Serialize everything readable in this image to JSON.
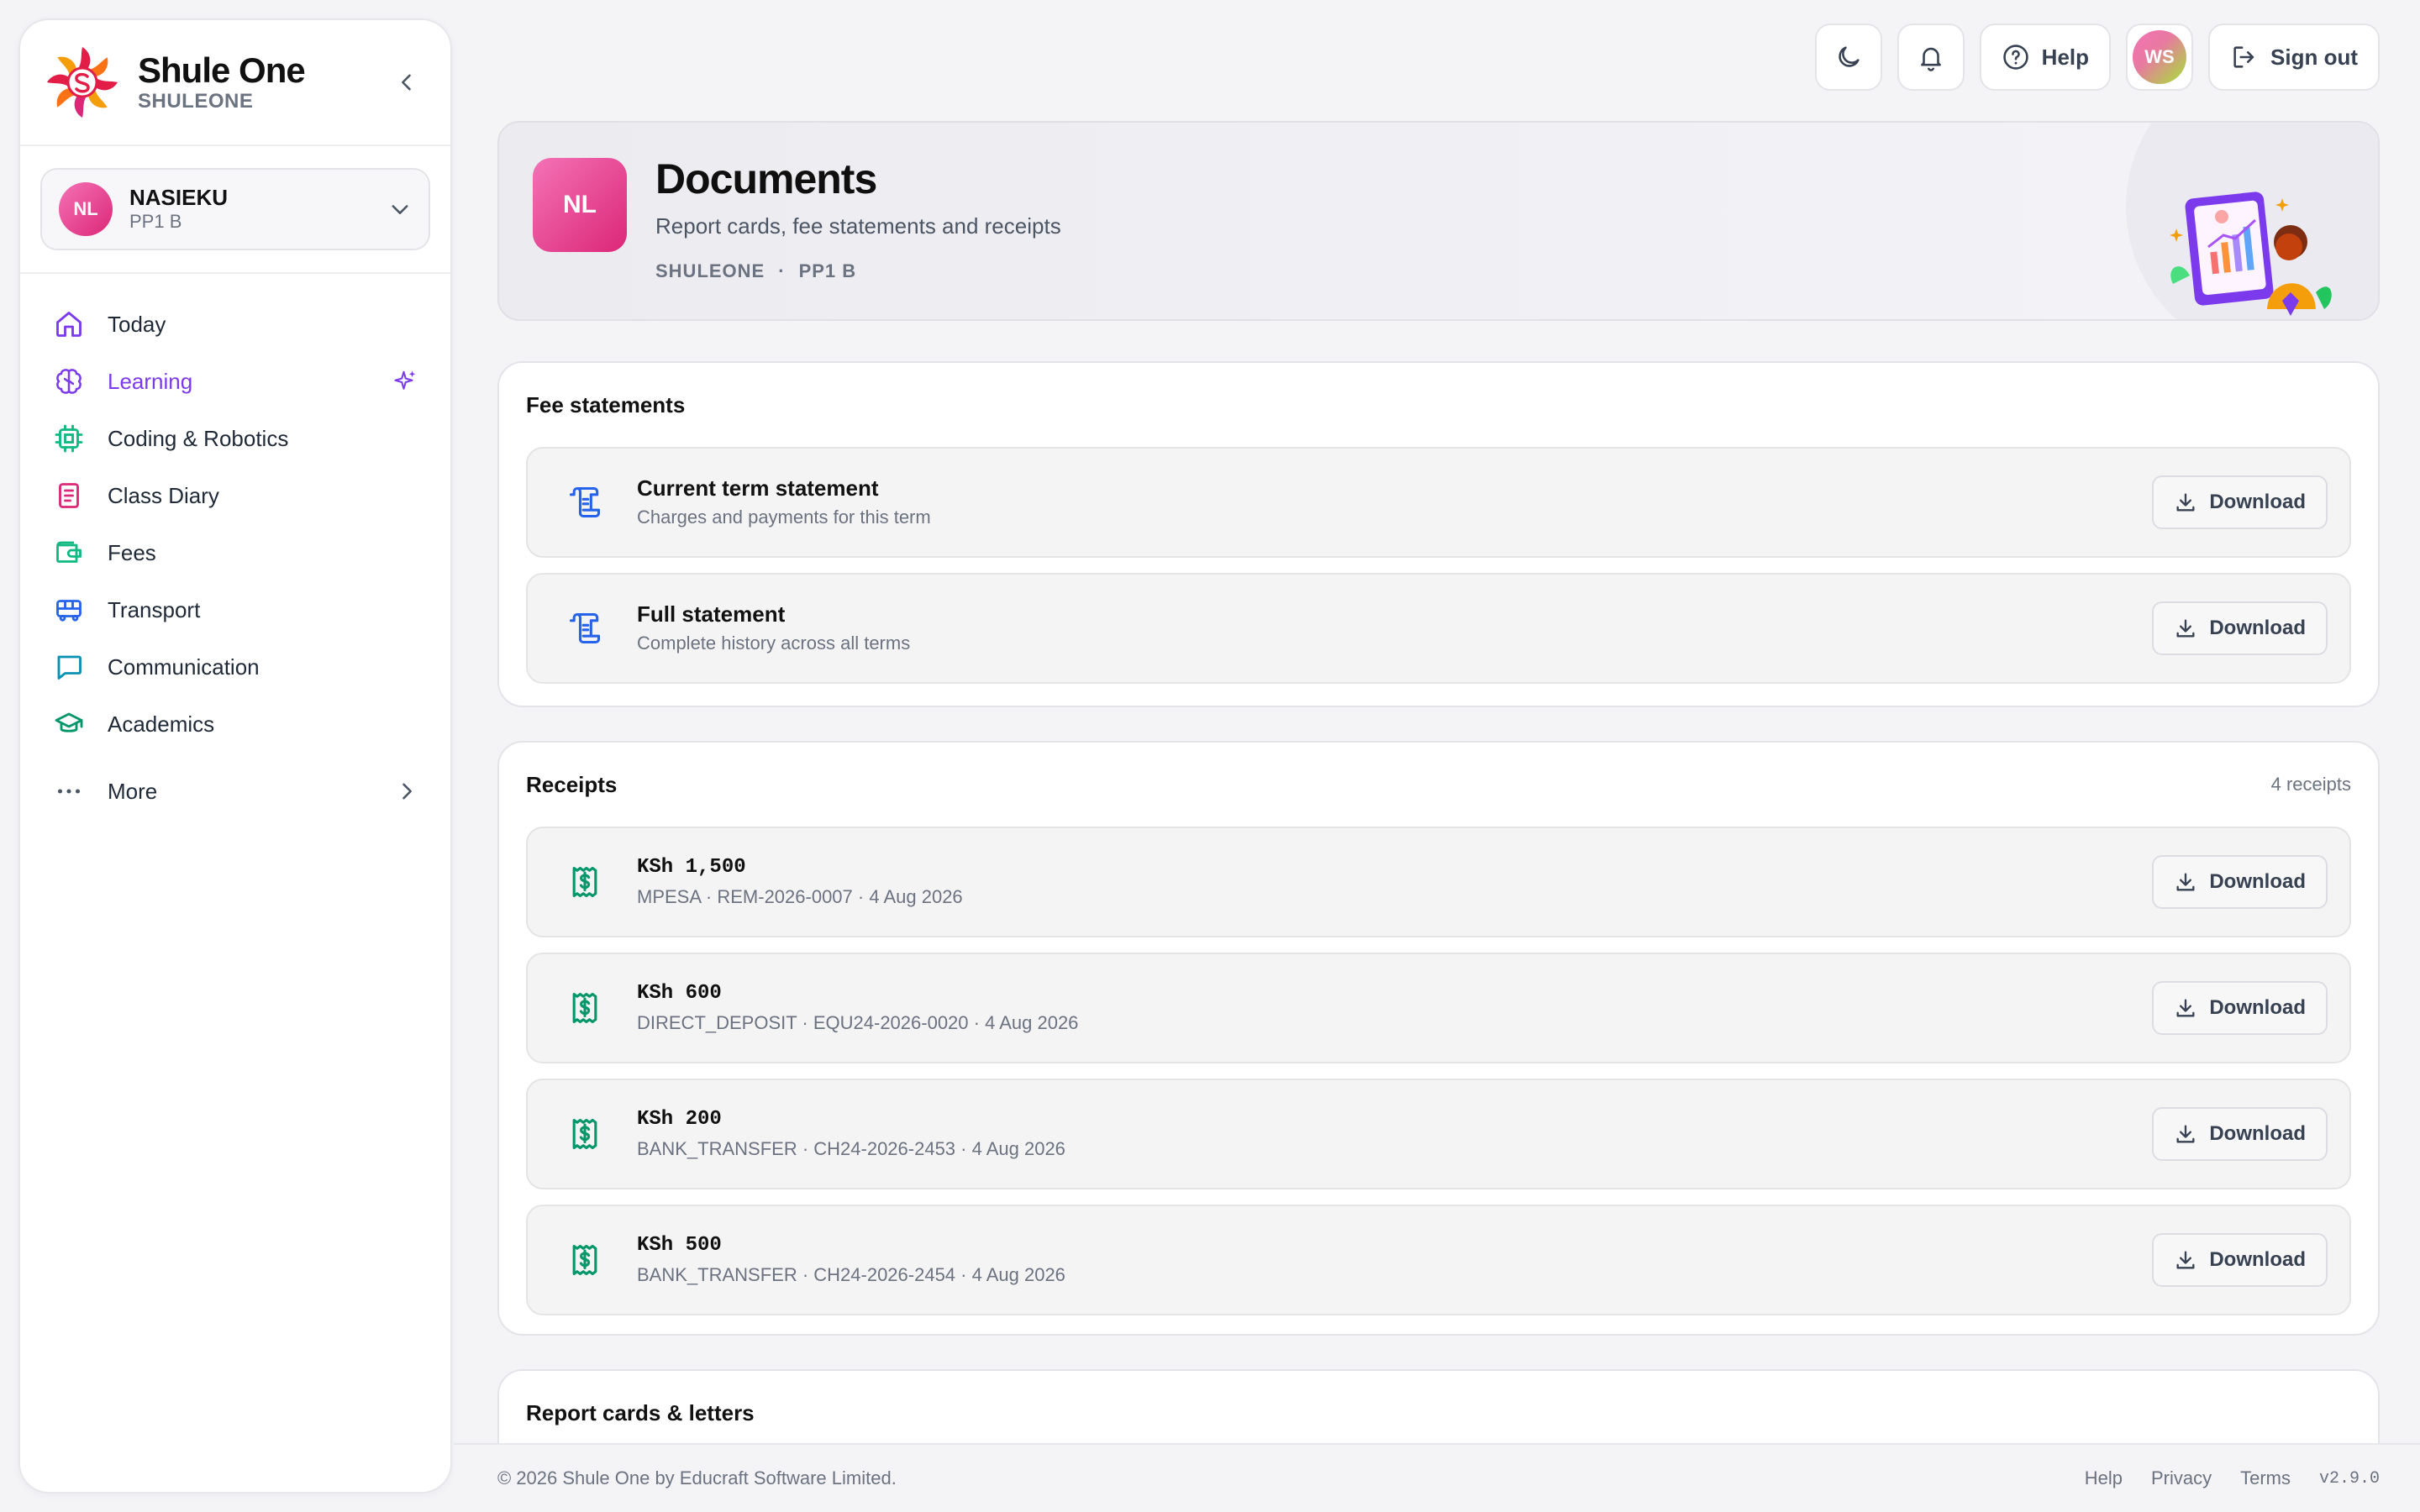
{
  "app": {
    "name": "Shule One",
    "tenant": "SHULEONE",
    "colors": {
      "accent": "#7c3aed",
      "brand_pink": "#db2777",
      "bg": "#f4f4f7"
    }
  },
  "student": {
    "initials": "NL",
    "name": "NASIEKU",
    "class": "PP1 B"
  },
  "sidebar": {
    "items": [
      {
        "label": "Today",
        "icon": "home-icon"
      },
      {
        "label": "Learning",
        "icon": "brain-icon",
        "badge_icon": "sparkles-icon"
      },
      {
        "label": "Coding & Robotics",
        "icon": "cpu-icon"
      },
      {
        "label": "Class Diary",
        "icon": "notebook-icon"
      },
      {
        "label": "Fees",
        "icon": "wallet-icon"
      },
      {
        "label": "Transport",
        "icon": "bus-icon"
      },
      {
        "label": "Communication",
        "icon": "message-icon"
      },
      {
        "label": "Academics",
        "icon": "graduation-cap-icon"
      }
    ],
    "more": "More"
  },
  "topbar": {
    "help": "Help",
    "user_initials": "WS",
    "sign_out": "Sign out"
  },
  "header": {
    "initials": "NL",
    "title": "Documents",
    "subtitle": "Report cards, fee statements and receipts",
    "school": "SHULEONE",
    "separator": "·",
    "class": "PP1 B"
  },
  "fee_statements": {
    "title": "Fee statements",
    "rows": [
      {
        "title": "Current term statement",
        "subtitle": "Charges and payments for this term",
        "action": "Download"
      },
      {
        "title": "Full statement",
        "subtitle": "Complete history across all terms",
        "action": "Download"
      }
    ]
  },
  "receipts": {
    "title": "Receipts",
    "count": "4 receipts",
    "rows": [
      {
        "amount": "KSh 1,500",
        "meta": "MPESA · REM-2026-0007 · 4 Aug 2026",
        "action": "Download"
      },
      {
        "amount": "KSh 600",
        "meta": "DIRECT_DEPOSIT · EQU24-2026-0020 · 4 Aug 2026",
        "action": "Download"
      },
      {
        "amount": "KSh 200",
        "meta": "BANK_TRANSFER · CH24-2026-2453 · 4 Aug 2026",
        "action": "Download"
      },
      {
        "amount": "KSh 500",
        "meta": "BANK_TRANSFER · CH24-2026-2454 · 4 Aug 2026",
        "action": "Download"
      }
    ]
  },
  "report_cards": {
    "title": "Report cards & letters"
  },
  "footer": {
    "copyright": "© 2026 Shule One by Educraft Software Limited.",
    "links": [
      "Help",
      "Privacy",
      "Terms"
    ],
    "version": "v2.9.0"
  }
}
